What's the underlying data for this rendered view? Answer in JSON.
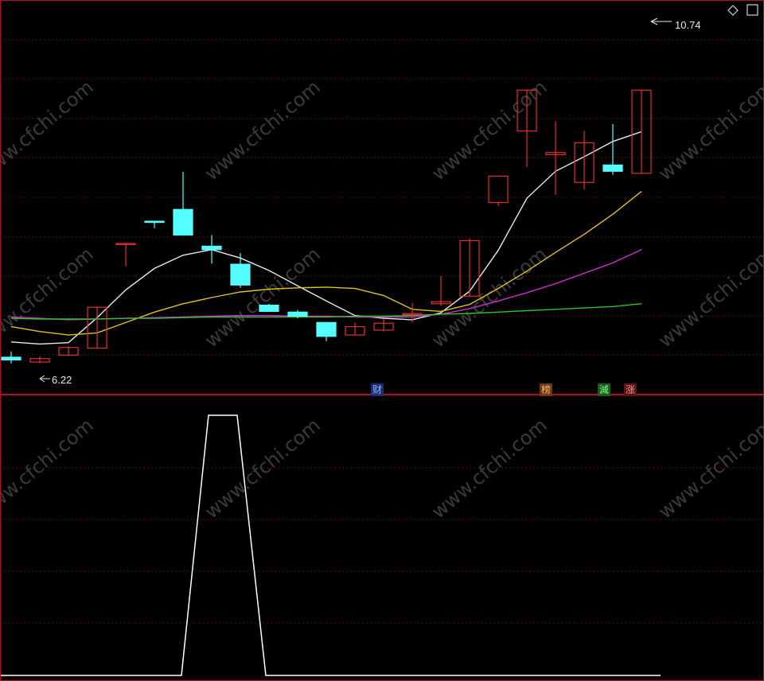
{
  "corner_icon": "diamond-outline-icon",
  "main_panel": {
    "max_price_label": "10.74",
    "min_price_label": "6.22",
    "signals": [
      {
        "text": "财",
        "bg": "#1b2f73",
        "color": "#8fb2ff"
      },
      {
        "text": "榜",
        "bg": "#6b3a12",
        "color": "#ffb070"
      },
      {
        "text": "減",
        "bg": "#1d5a1d",
        "color": "#7cff7c"
      },
      {
        "text": "涨",
        "bg": "#5a1515",
        "color": "#ff8a8a"
      }
    ]
  },
  "watermark": "www.cfchi.com",
  "colors": {
    "background": "#000000",
    "frame": "#b0101f",
    "grid": "#5a0c10",
    "up_candle": "#e03030",
    "down_candle": "#54ffff",
    "ma5": "#e8e8e8",
    "ma10": "#e0c020",
    "ma20": "#d030d0",
    "ma60": "#30c030",
    "indicator": "#ffffff"
  },
  "chart_data": [
    {
      "type": "candlestick",
      "ylim": [
        6.0,
        11.0
      ],
      "candles": [
        {
          "o": 6.31,
          "h": 6.39,
          "l": 6.22,
          "c": 6.27
        },
        {
          "o": 6.24,
          "h": 6.32,
          "l": 6.22,
          "c": 6.29
        },
        {
          "o": 6.34,
          "h": 6.47,
          "l": 6.33,
          "c": 6.45
        },
        {
          "o": 6.44,
          "h": 7.04,
          "l": 6.44,
          "c": 7.03
        },
        {
          "o": 7.95,
          "h": 7.95,
          "l": 7.62,
          "c": 7.95
        },
        {
          "o": 8.27,
          "h": 8.27,
          "l": 8.17,
          "c": 8.26
        },
        {
          "o": 8.44,
          "h": 8.98,
          "l": 8.19,
          "c": 8.07
        },
        {
          "o": 7.91,
          "h": 8.07,
          "l": 7.66,
          "c": 7.86
        },
        {
          "o": 7.65,
          "h": 7.81,
          "l": 7.31,
          "c": 7.35
        },
        {
          "o": 7.06,
          "h": 7.08,
          "l": 7.02,
          "c": 6.97
        },
        {
          "o": 6.96,
          "h": 6.99,
          "l": 6.87,
          "c": 6.9
        },
        {
          "o": 6.81,
          "h": 6.81,
          "l": 6.54,
          "c": 6.61
        },
        {
          "o": 6.63,
          "h": 6.81,
          "l": 6.63,
          "c": 6.75
        },
        {
          "o": 6.7,
          "h": 6.86,
          "l": 6.68,
          "c": 6.8
        },
        {
          "o": 6.94,
          "h": 7.09,
          "l": 6.81,
          "c": 6.94
        },
        {
          "o": 7.08,
          "h": 7.48,
          "l": 7.05,
          "c": 7.11
        },
        {
          "o": 7.19,
          "h": 8.02,
          "l": 7.19,
          "c": 7.99
        },
        {
          "o": 8.54,
          "h": 8.55,
          "l": 8.49,
          "c": 8.92
        },
        {
          "o": 9.57,
          "h": 10.16,
          "l": 9.05,
          "c": 10.16
        },
        {
          "o": 9.23,
          "h": 9.71,
          "l": 8.65,
          "c": 9.26
        },
        {
          "o": 8.83,
          "h": 9.57,
          "l": 8.73,
          "c": 9.4
        },
        {
          "o": 9.08,
          "h": 9.67,
          "l": 8.94,
          "c": 8.99
        },
        {
          "o": 8.96,
          "h": 10.16,
          "l": 8.96,
          "c": 10.16
        }
      ],
      "series": [
        {
          "name": "MA5",
          "values": [
            6.53,
            6.5,
            6.52,
            6.88,
            7.28,
            7.59,
            7.78,
            7.86,
            7.74,
            7.56,
            7.34,
            7.12,
            6.91,
            6.87,
            6.85,
            6.95,
            7.26,
            7.85,
            8.6,
            8.99,
            9.2,
            9.42,
            9.56
          ]
        },
        {
          "name": "MA10",
          "values": [
            6.75,
            6.68,
            6.63,
            6.66,
            6.81,
            6.96,
            7.08,
            7.17,
            7.25,
            7.29,
            7.31,
            7.32,
            7.3,
            7.2,
            7.0,
            6.97,
            7.07,
            7.3,
            7.55,
            7.82,
            8.08,
            8.37,
            8.7
          ]
        },
        {
          "name": "MA20",
          "values": [
            6.89,
            6.87,
            6.85,
            6.86,
            6.87,
            6.88,
            6.89,
            6.9,
            6.91,
            6.91,
            6.9,
            6.9,
            6.89,
            6.89,
            6.89,
            6.93,
            7.01,
            7.12,
            7.24,
            7.37,
            7.52,
            7.67,
            7.86
          ]
        },
        {
          "name": "MA60",
          "values": [
            6.87,
            6.86,
            6.86,
            6.86,
            6.87,
            6.87,
            6.88,
            6.89,
            6.89,
            6.89,
            6.89,
            6.89,
            6.9,
            6.9,
            6.91,
            6.93,
            6.94,
            6.96,
            6.98,
            7.0,
            7.02,
            7.04,
            7.08
          ]
        }
      ]
    },
    {
      "type": "line",
      "ylim": [
        0,
        1
      ],
      "series": [
        {
          "points": [
            [
              0,
              0
            ],
            [
              228,
              0
            ],
            [
              262,
              1
            ],
            [
              298,
              1
            ],
            [
              334,
              0
            ],
            [
              830,
              0
            ]
          ]
        }
      ]
    }
  ]
}
